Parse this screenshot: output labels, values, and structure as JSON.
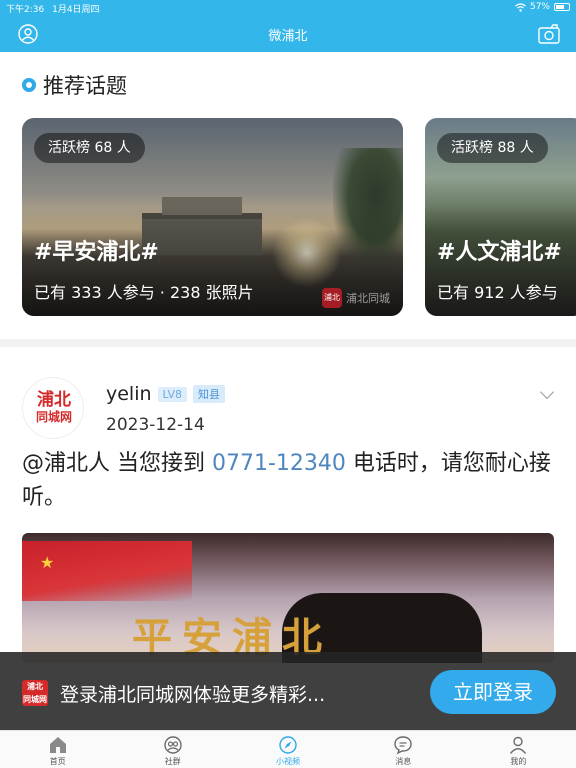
{
  "status_bar": {
    "time": "下午2:36",
    "date": "1月4日周四",
    "battery": "57%"
  },
  "nav": {
    "title": "微浦北"
  },
  "topics": {
    "section_title": "推荐话题",
    "cards": [
      {
        "rank": "活跃榜 68 人",
        "title": "#早安浦北#",
        "stats": "已有 333 人参与 · 238 张照片",
        "watermark": "浦北同城"
      },
      {
        "rank": "活跃榜 88 人",
        "title": "#人文浦北#",
        "stats": "已有 912 人参与"
      }
    ]
  },
  "post": {
    "logo_top": "浦北",
    "logo_bottom": "同城网",
    "username": "yelin",
    "level": "LV8",
    "role": "知县",
    "date": "2023-12-14",
    "text_before": "@浦北人 当您接到",
    "phone": "0771-12340",
    "text_after": "电话时，请您耐心接听。",
    "image_text": "平安浦北"
  },
  "login_banner": {
    "logo_top": "浦北",
    "logo_bottom": "同城网",
    "text": "登录浦北同城网体验更多精彩...",
    "button": "立即登录"
  },
  "tabs": [
    {
      "label": "首页",
      "icon": "home-icon"
    },
    {
      "label": "社群",
      "icon": "community-icon"
    },
    {
      "label": "小视频",
      "icon": "compass-icon",
      "active": true
    },
    {
      "label": "消息",
      "icon": "message-icon"
    },
    {
      "label": "我的",
      "icon": "profile-icon"
    }
  ],
  "colors": {
    "accent": "#33b6ea",
    "button": "#33aaec",
    "phone_link": "#4f86c0"
  }
}
